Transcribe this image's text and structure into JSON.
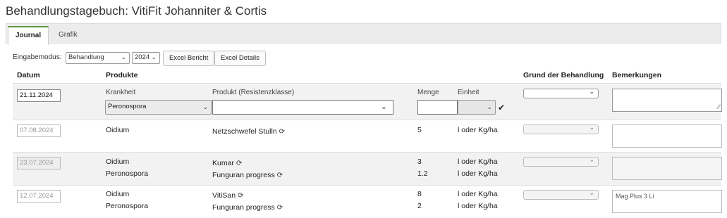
{
  "title": "Behandlungstagebuch: VitiFit Johanniter & Cortis",
  "tabs": [
    {
      "label": "Journal"
    },
    {
      "label": "Grafik"
    }
  ],
  "toolbar": {
    "mode_label": "Eingabemodus:",
    "mode_value": "Behandlung",
    "year_value": "2024",
    "excel_report": "Excel Bericht",
    "excel_details": "Excel Details"
  },
  "columns": {
    "datum": "Datum",
    "produkte": "Produkte",
    "grund": "Grund der Behandlung",
    "bemerkungen": "Bemerkungen"
  },
  "entry_form": {
    "date": "21.11.2024",
    "krankheit_label": "Krankheit",
    "produkt_label": "Produkt (Resistenzklasse)",
    "menge_label": "Menge",
    "einheit_label": "Einheit",
    "krankheit_value": "Peronospora"
  },
  "entries": [
    {
      "date": "07.08.2024",
      "items": [
        {
          "krankheit": "Oidium",
          "produkt": "Netzschwefel Stulln",
          "menge": "5",
          "einheit": "l oder Kg/ha"
        }
      ],
      "bemerkung": ""
    },
    {
      "date": "23.07.2024",
      "items": [
        {
          "krankheit": "Oidium",
          "produkt": "Kumar",
          "menge": "3",
          "einheit": "l oder Kg/ha"
        },
        {
          "krankheit": "Peronospora",
          "produkt": "Funguran progress",
          "menge": "1.2",
          "einheit": "l oder Kg/ha"
        }
      ],
      "bemerkung": ""
    },
    {
      "date": "12.07.2024",
      "items": [
        {
          "krankheit": "Oidium",
          "produkt": "VitiSan",
          "menge": "8",
          "einheit": "l oder Kg/ha"
        },
        {
          "krankheit": "Peronospora",
          "produkt": "Funguran progress",
          "menge": "2",
          "einheit": "l oder Kg/ha"
        }
      ],
      "bemerkung": "Mag Plus 3 Li"
    }
  ],
  "icons": {
    "refresh": "refresh-icon",
    "check": "check-icon",
    "chevron": "chevron-down-icon"
  },
  "colors": {
    "active_tab_accent": "#5b9b3a",
    "row_shade": "#f2f2f2"
  }
}
